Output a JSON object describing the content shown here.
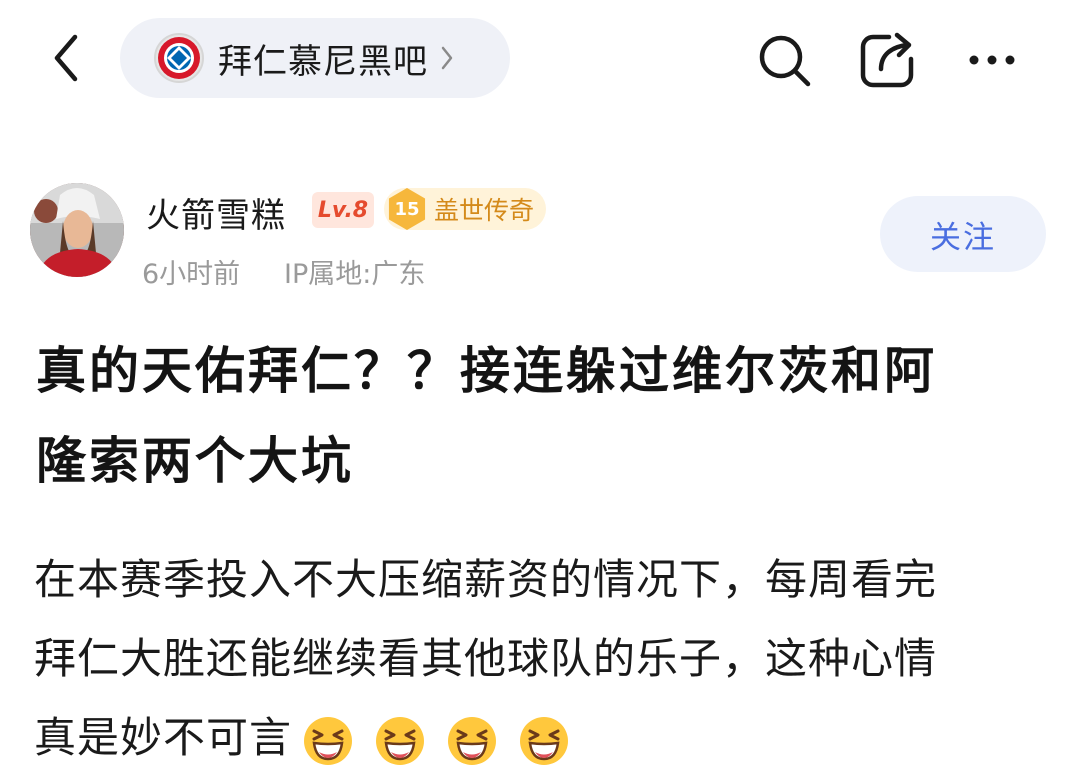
{
  "top_bar": {
    "forum_name": "拜仁慕尼黑吧"
  },
  "author": {
    "name": "火箭雪糕",
    "level": "Lv.8",
    "medal_number": "15",
    "title": "盖世传奇",
    "time": "6小时前",
    "location": "IP属地:广东",
    "follow_label": "关注"
  },
  "post": {
    "title_line1": "真的天佑拜仁？？接连躲过维尔茨和阿",
    "title_line2": "隆索两个大坑",
    "body_line1": "在本赛季投入不大压缩薪资的情况下，每周看完",
    "body_line2": "拜仁大胜还能继续看其他球队的乐子，这种心情",
    "body_line3": "真是妙不可言"
  },
  "icons": {
    "back": "chevron-left-icon",
    "forum_logo": "fc-bayern-logo",
    "search": "search-icon",
    "share": "share-icon",
    "more": "more-icon",
    "emoji": "grinning-squint-emoji"
  },
  "colors": {
    "accent_blue": "#4a6ee0",
    "level_red": "#e54b2e",
    "medal_gold": "#f6b73c"
  }
}
